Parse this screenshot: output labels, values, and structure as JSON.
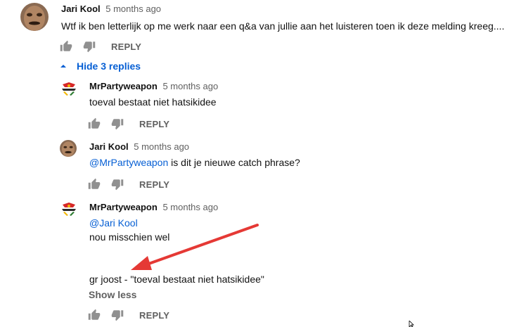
{
  "thread": {
    "top_comment": {
      "author": "Jari Kool",
      "time": "5 months ago",
      "text": "Wtf ik ben letterlijk op me werk naar een q&a van jullie aan het luisteren toen ik deze melding kreeg....",
      "reply_label": "REPLY"
    },
    "toggle_label": "Hide 3 replies",
    "replies": [
      {
        "author": "MrPartyweapon",
        "time": "5 months ago",
        "text": "toeval bestaat niet hatsikidee",
        "reply_label": "REPLY"
      },
      {
        "author": "Jari Kool",
        "time": "5 months ago",
        "mention": "@MrPartyweapon",
        "text": " is dit je nieuwe catch phrase?",
        "reply_label": "REPLY"
      },
      {
        "author": "MrPartyweapon",
        "time": "5 months ago",
        "mention": "@Jari Kool",
        "line1": "nou misschien wel",
        "line2": "gr joost - \"toeval bestaat niet hatsikidee\"",
        "show_less": "Show less",
        "reply_label": "REPLY"
      }
    ]
  },
  "colors": {
    "link": "#065fd4",
    "secondary_text": "#606060",
    "annotation_arrow": "#e53935"
  },
  "icons": [
    "thumb-up-icon",
    "thumb-down-icon",
    "caret-up-icon",
    "mouse-cursor-icon"
  ]
}
